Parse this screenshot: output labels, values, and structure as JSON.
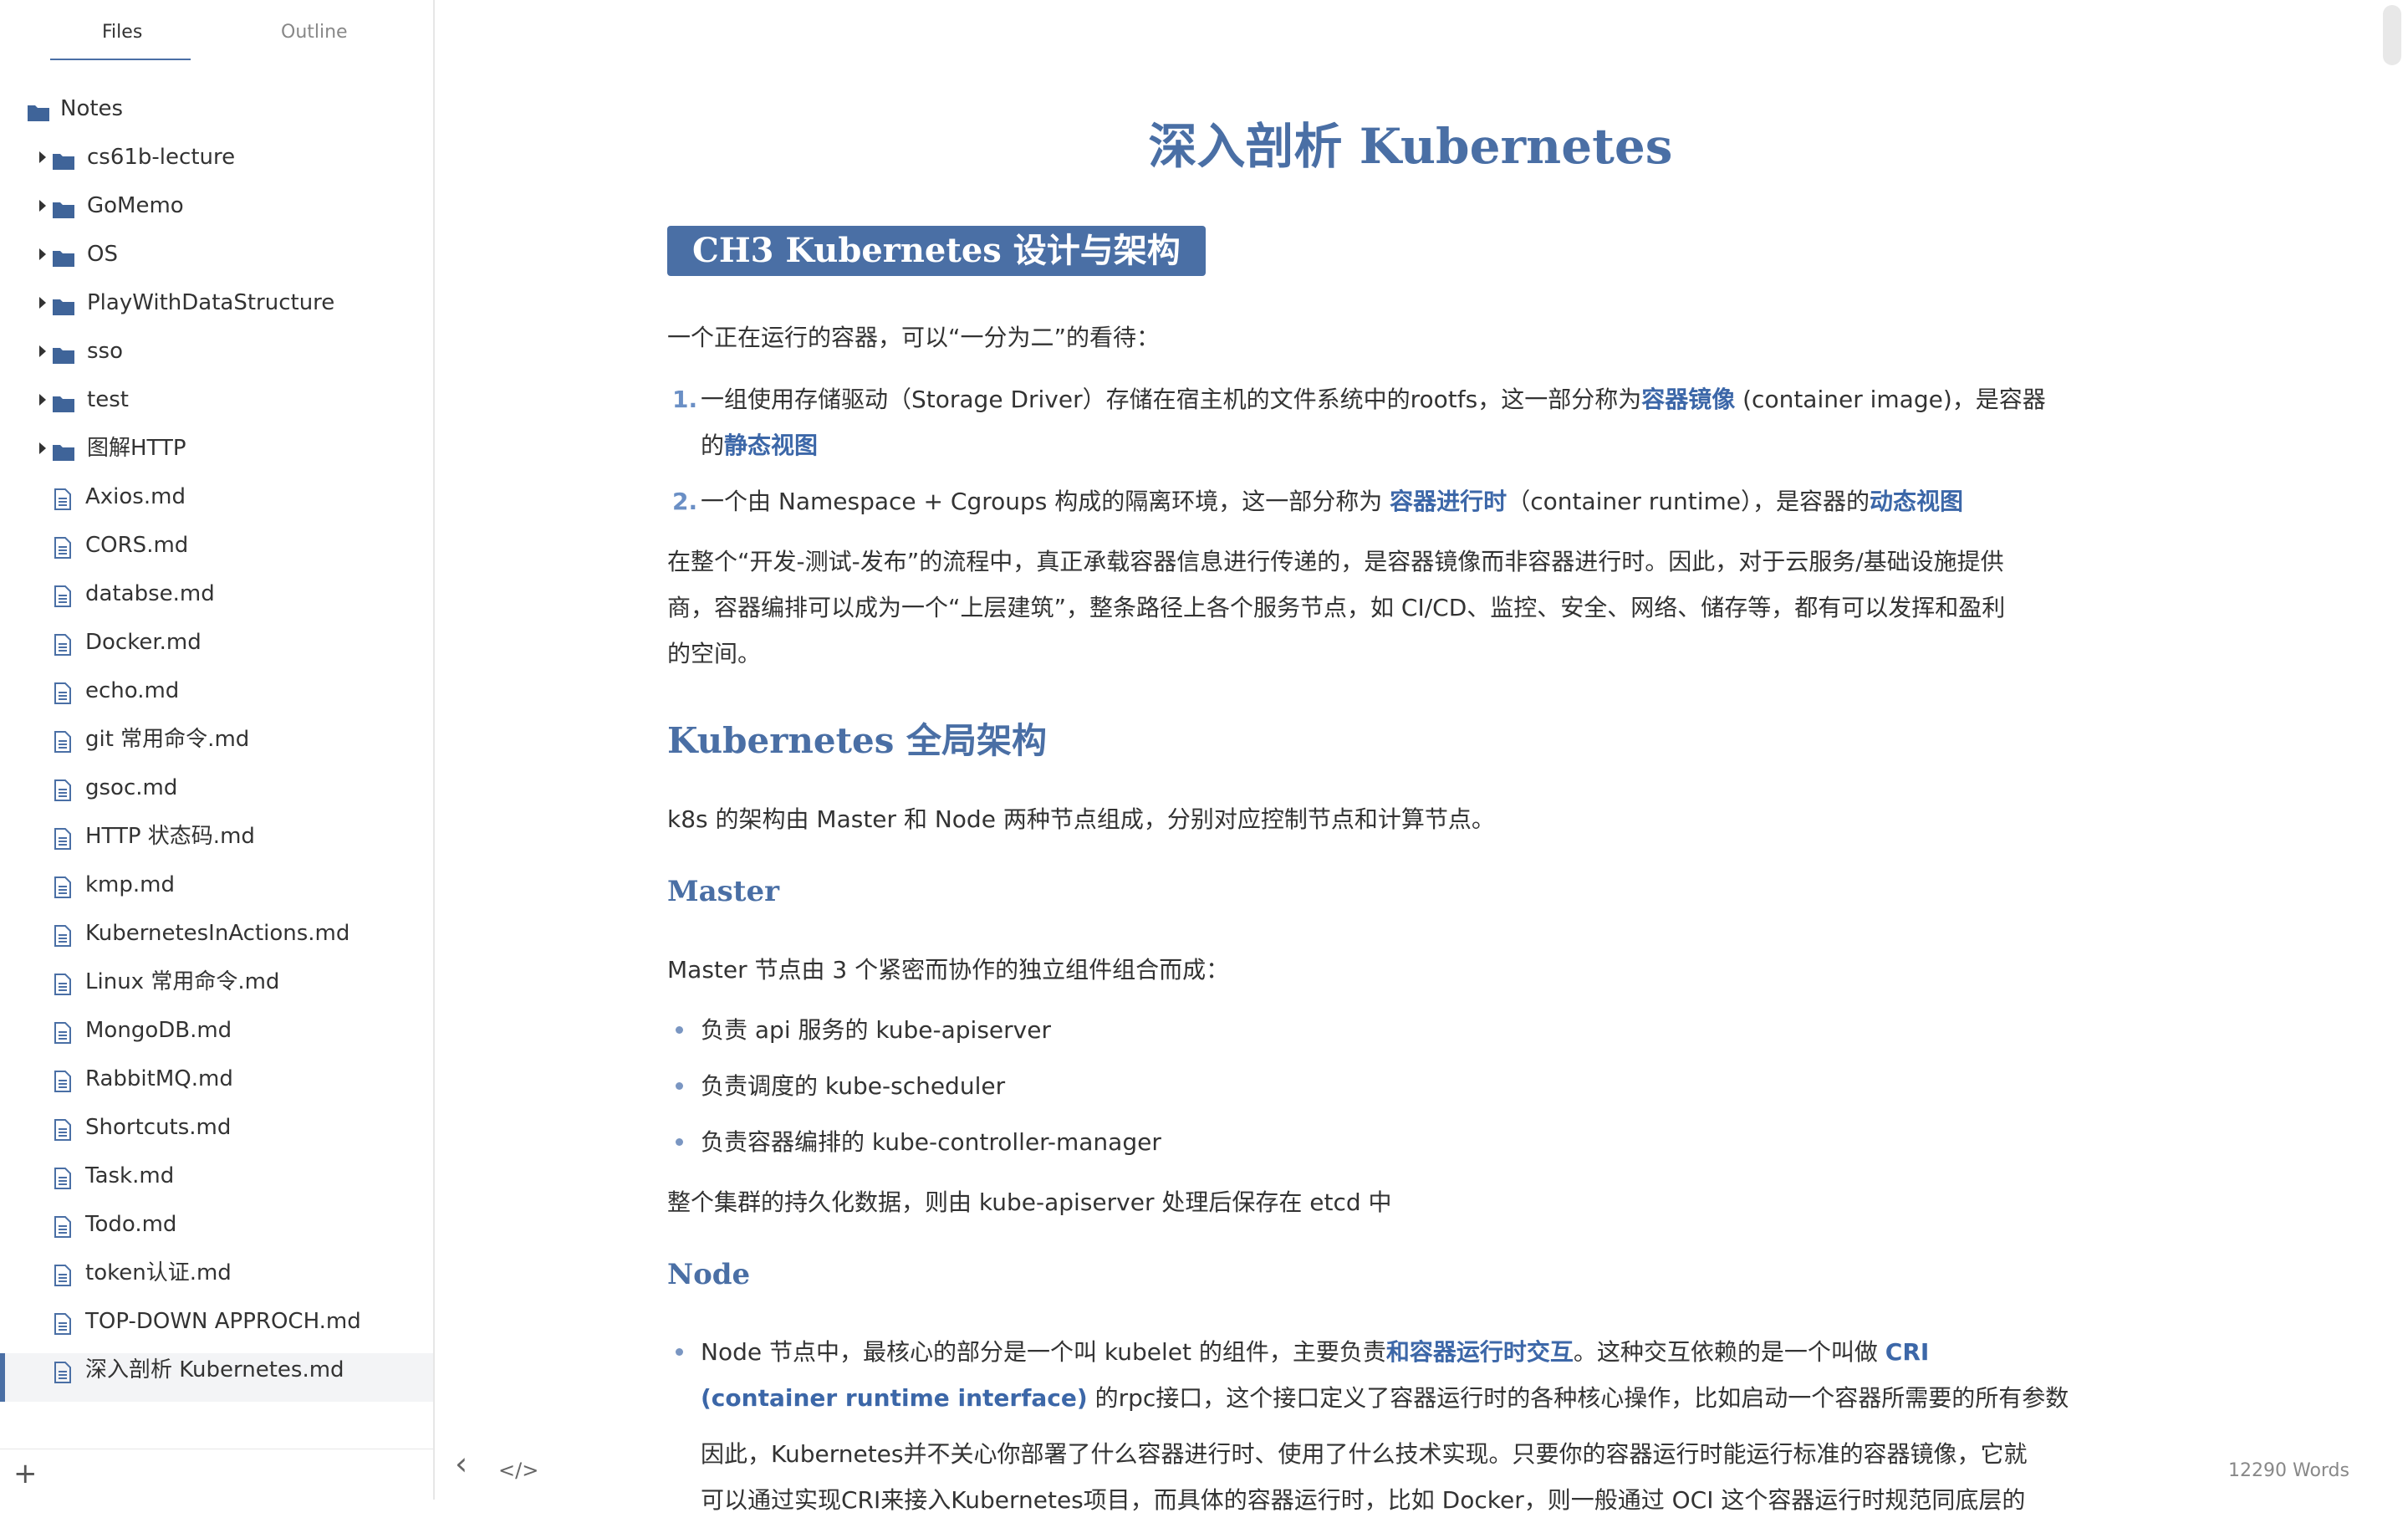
{
  "sidebar": {
    "tabs": [
      {
        "label": "Files"
      },
      {
        "label": "Outline"
      }
    ],
    "root": {
      "label": "Notes"
    },
    "folders": [
      {
        "label": "cs61b-lecture"
      },
      {
        "label": "GoMemo"
      },
      {
        "label": "OS"
      },
      {
        "label": "PlayWithDataStructure"
      },
      {
        "label": "sso"
      },
      {
        "label": "test"
      },
      {
        "label": "图解HTTP"
      }
    ],
    "files": [
      {
        "label": "Axios.md"
      },
      {
        "label": "CORS.md"
      },
      {
        "label": "databse.md"
      },
      {
        "label": "Docker.md"
      },
      {
        "label": "echo.md"
      },
      {
        "label": "git 常用命令.md"
      },
      {
        "label": "gsoc.md"
      },
      {
        "label": "HTTP 状态码.md"
      },
      {
        "label": "kmp.md"
      },
      {
        "label": "KubernetesInActions.md"
      },
      {
        "label": "Linux 常用命令.md"
      },
      {
        "label": "MongoDB.md"
      },
      {
        "label": "RabbitMQ.md"
      },
      {
        "label": "Shortcuts.md"
      },
      {
        "label": "Task.md"
      },
      {
        "label": "Todo.md"
      },
      {
        "label": "token认证.md"
      },
      {
        "label": "TOP-DOWN APPROCH.md"
      },
      {
        "label": "深入剖析 Kubernetes.md"
      }
    ],
    "add_label": "+"
  },
  "doc": {
    "title": "深入剖析 Kubernetes",
    "ch3": "CH3 Kubernetes 设计与架构",
    "intro": "一个正在运行的容器，可以“一分为二”的看待：",
    "ol": [
      {
        "num": "1.",
        "a": "一组使用存储驱动（Storage Driver）存储在宿主机的文件系统中的rootfs，这一部分称为",
        "b": "容器镜像",
        "c": " (container image)，是容器",
        "d": "的",
        "e": "静态视图"
      },
      {
        "num": "2.",
        "a": "一个由 Namespace + Cgroups 构成的隔离环境，这一部分称为 ",
        "b": "容器进行时",
        "c": "（container runtime），是容器的",
        "d": "动态视图"
      }
    ],
    "para1": [
      "在整个“开发-测试-发布”的流程中，真正承载容器信息进行传递的，是容器镜像而非容器进行时。因此，对于云服务/基础设施提供",
      "商，容器编排可以成为一个“上层建筑”，整条路径上各个服务节点，如 CI/CD、监控、安全、网络、储存等，都有可以发挥和盈利",
      "的空间。"
    ],
    "h2_arch": "Kubernetes 全局架构",
    "arch_text": "k8s 的架构由 Master 和 Node 两种节点组成，分别对应控制节点和计算节点。",
    "h3_master": "Master",
    "master_intro": "Master 节点由 3 个紧密而协作的独立组件组合而成：",
    "master_items": [
      "负责 api 服务的 kube-apiserver",
      "负责调度的 kube-scheduler",
      "负责容器编排的 kube-controller-manager"
    ],
    "etcd_text": "整个集群的持久化数据，则由 kube-apiserver 处理后保存在 etcd 中",
    "h3_node": "Node",
    "node_item": {
      "a": "Node 节点中，最核心的部分是一个叫 kubelet 的组件，主要负责",
      "b": "和容器运行时交互",
      "c": "。这种交互依赖的是一个叫做 ",
      "d": "CRI",
      "e": "(container runtime interface)",
      "f": " 的rpc接口，这个接口定义了容器运行时的各种核心操作，比如启动一个容器所需要的所有参数"
    },
    "node_para": [
      "因此，Kubernetes并不关心你部署了什么容器进行时、使用了什么技术实现。只要你的容器运行时能运行标准的容器镜像，它就",
      "可以通过实现CRI来接入Kubernetes项目，而具体的容器运行时，比如 Docker，则一般通过 OCI 这个容器运行时规范同底层的"
    ]
  },
  "footer": {
    "word_count": "12290 Words",
    "back_symbol": "‹",
    "source_symbol": "</>"
  },
  "colors": {
    "accent": "#4a6fa5",
    "link": "#3c67a8"
  }
}
